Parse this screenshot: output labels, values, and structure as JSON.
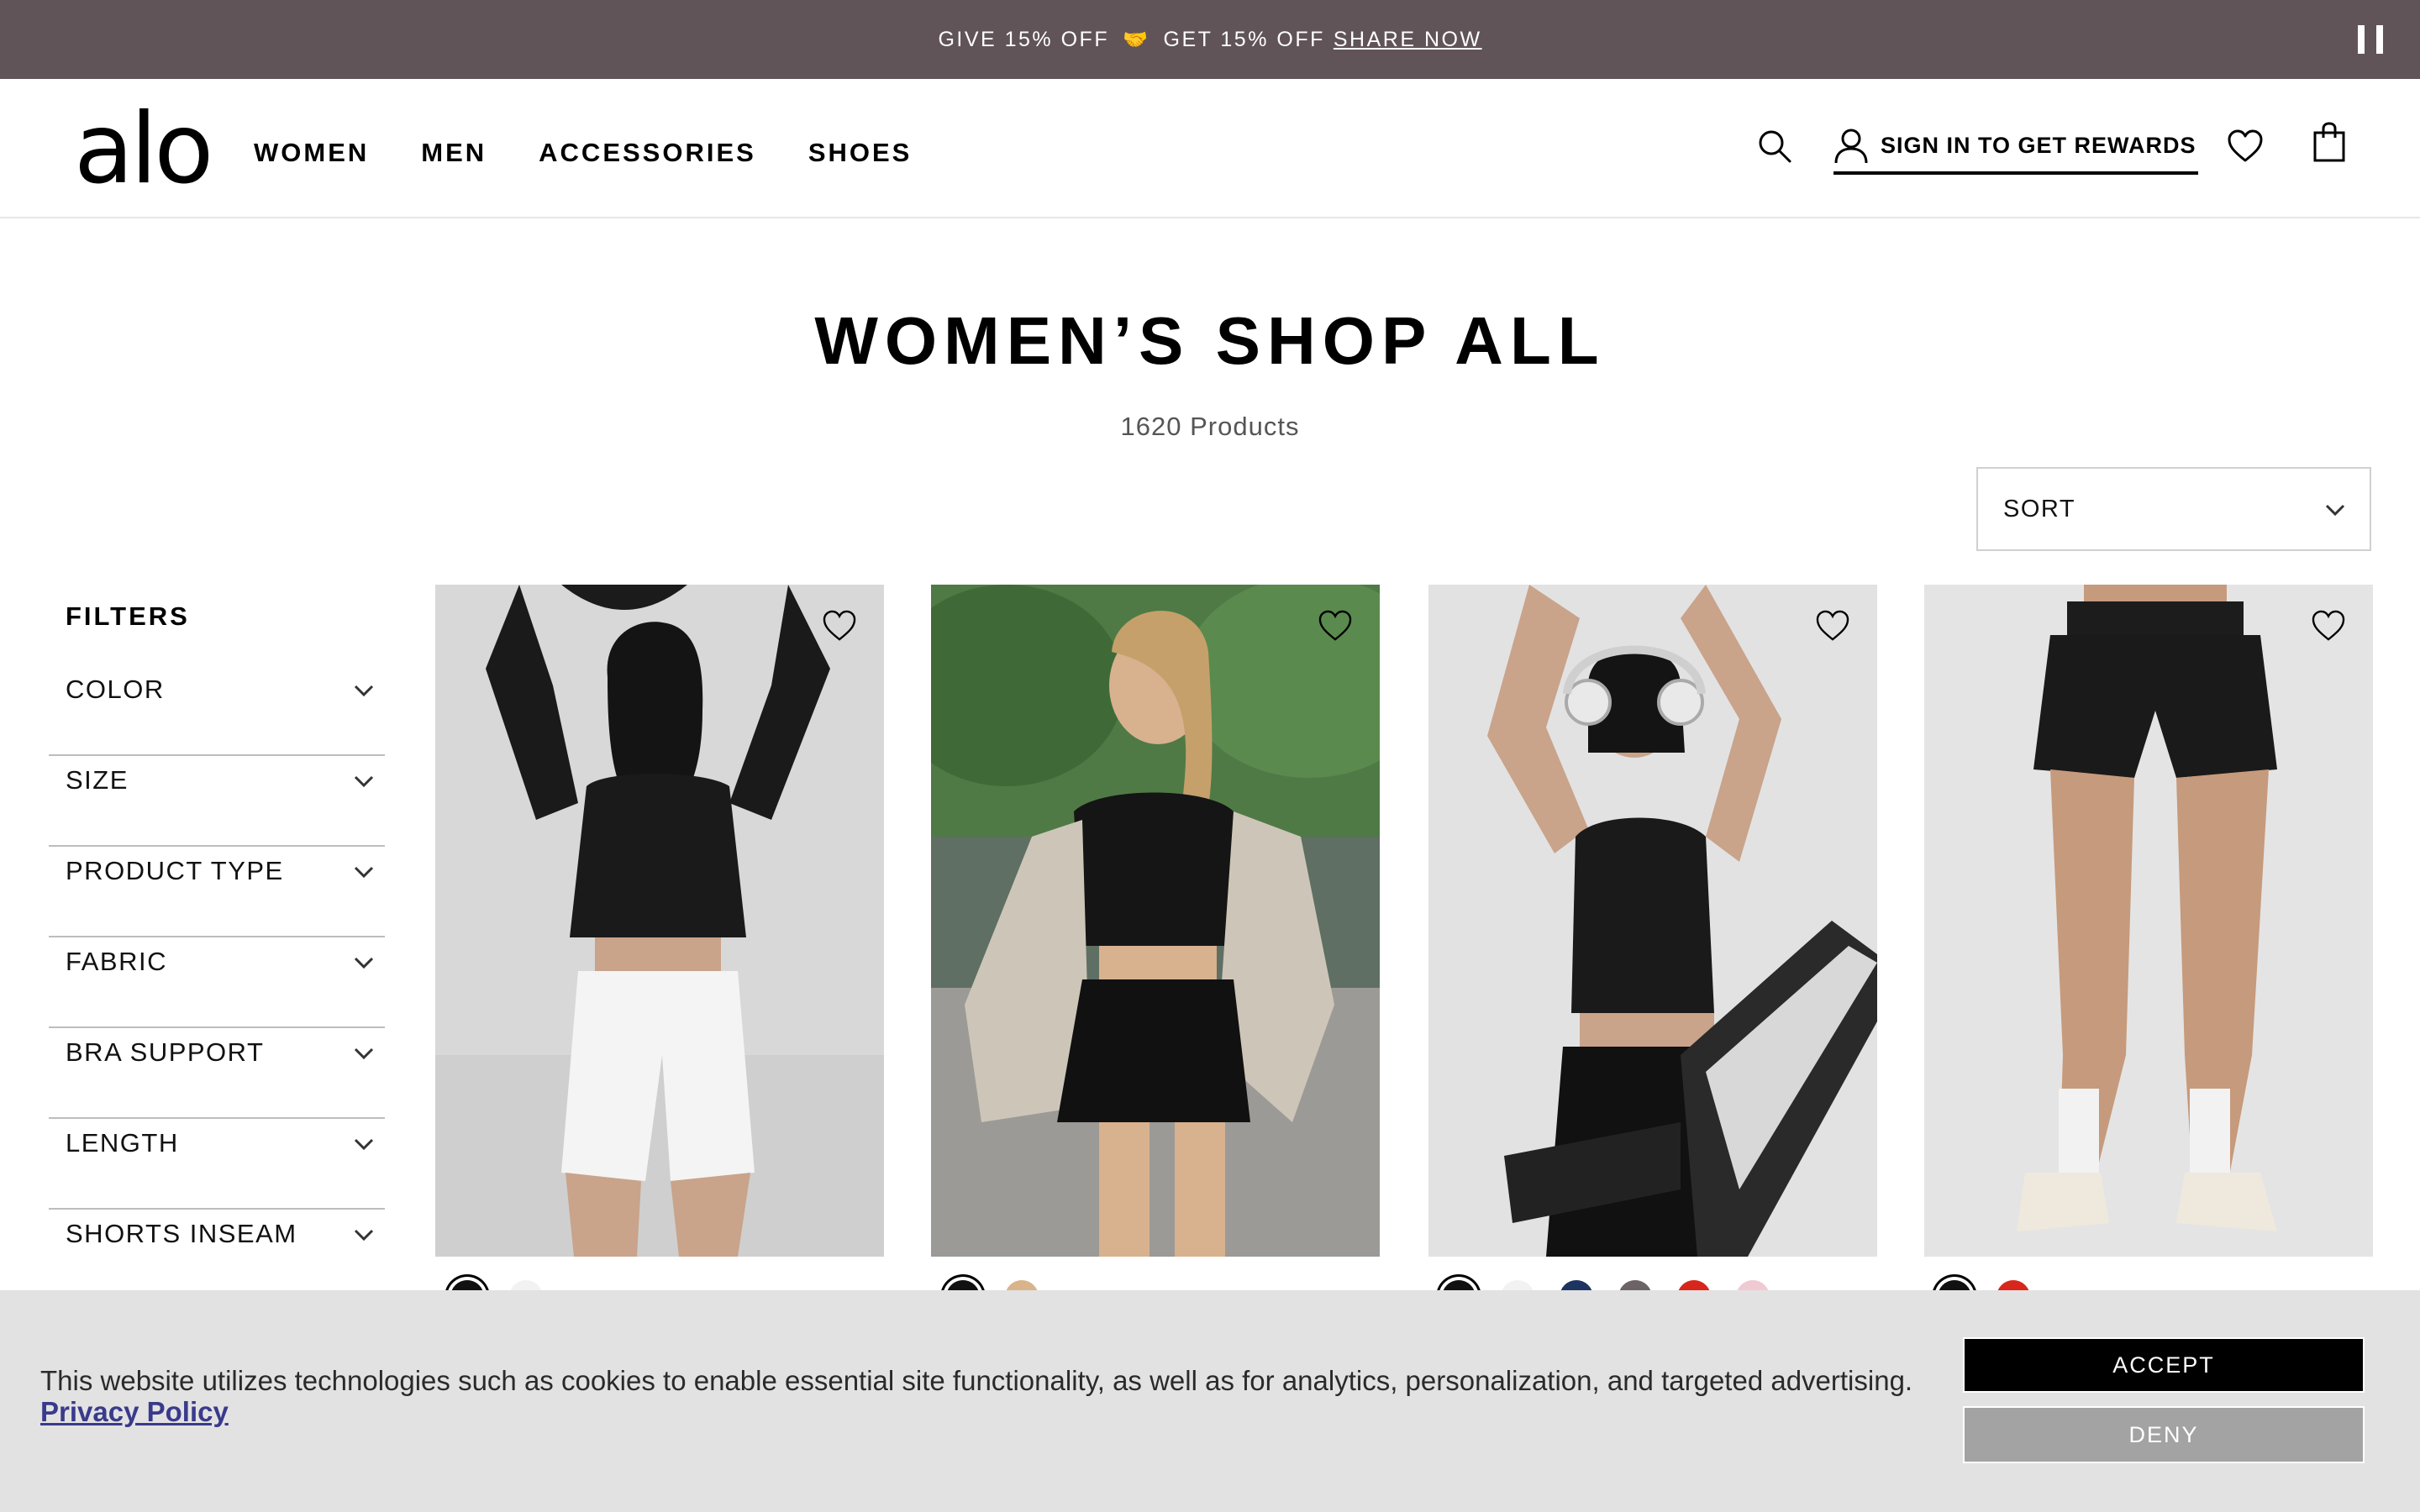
{
  "promo": {
    "give_text": "GIVE 15% OFF",
    "gift_glyph": "🤝",
    "get_text": "GET 15% OFF",
    "share_label": "SHARE NOW"
  },
  "header": {
    "logo": "alo",
    "nav": [
      "WOMEN",
      "MEN",
      "ACCESSORIES",
      "SHOES"
    ],
    "account_label": "SIGN IN TO GET REWARDS",
    "icons": [
      "search-icon",
      "user-icon",
      "heart-icon",
      "bag-icon"
    ]
  },
  "page": {
    "title": "WOMEN’S SHOP ALL",
    "product_count": "1620 Products",
    "sort_label": "SORT"
  },
  "filters": {
    "title": "FILTERS",
    "items": [
      "COLOR",
      "SIZE",
      "PRODUCT TYPE",
      "FABRIC",
      "BRA SUPPORT",
      "LENGTH",
      "SHORTS INSEAM"
    ]
  },
  "products": [
    {
      "image": "model-black-long-sleeve-crop-white-shorts",
      "swatches": [
        "#111111",
        "#f2f2f2"
      ]
    },
    {
      "image": "model-black-crop-top-black-skirt-park",
      "swatches": [
        "#111111",
        "#d9b48a"
      ]
    },
    {
      "image": "model-black-tank-headphones-treadmill",
      "swatches": [
        "#111111",
        "#f2f2f2",
        "#1d3461",
        "#6b6365",
        "#d9261c",
        "#f1c9d3"
      ]
    },
    {
      "image": "model-black-running-shorts-sneakers",
      "swatches": [
        "#111111",
        "#d9261c"
      ]
    }
  ],
  "cookie": {
    "text": "This website utilizes technologies such as cookies to enable essential site functionality, as well as for analytics, personalization, and targeted advertising.",
    "privacy_label": "Privacy Policy",
    "accept_label": "ACCEPT",
    "deny_label": "DENY"
  },
  "colors": {
    "promo_bg": "#615459",
    "cookie_bg": "#e2e2e2",
    "deny_bg": "#a3a3a3"
  }
}
